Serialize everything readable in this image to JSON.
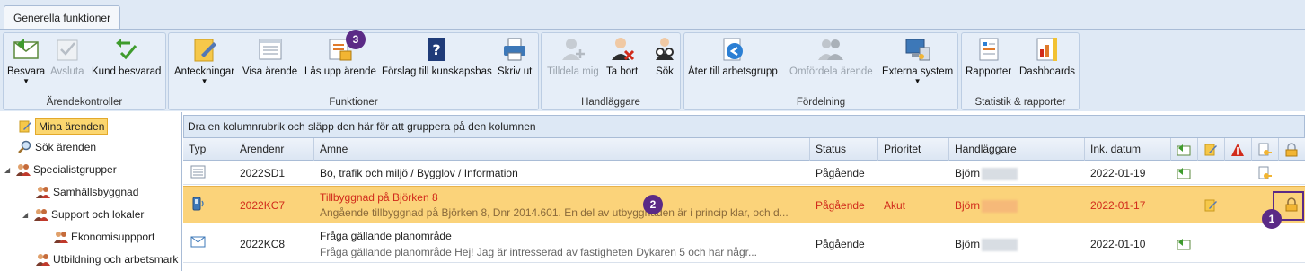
{
  "tab": {
    "label": "Generella funktioner"
  },
  "ribbon": {
    "groups": [
      {
        "caption": "Ärendekontroller",
        "buttons": [
          {
            "label": "Besvara",
            "dropdown": true,
            "enabled": true,
            "icon": "reply-envelope-icon"
          },
          {
            "label": "Avsluta",
            "enabled": false,
            "icon": "check-list-icon"
          },
          {
            "label": "Kund besvarad",
            "enabled": true,
            "icon": "customer-replied-icon"
          }
        ]
      },
      {
        "caption": "Funktioner",
        "buttons": [
          {
            "label": "Anteckningar",
            "dropdown": true,
            "enabled": true,
            "icon": "notes-icon"
          },
          {
            "label": "Visa ärende",
            "enabled": true,
            "icon": "view-case-icon"
          },
          {
            "label": "Lås upp ärende",
            "enabled": true,
            "icon": "unlock-case-icon"
          },
          {
            "label": "Förslag till kunskapsbas",
            "enabled": true,
            "icon": "knowledge-base-icon"
          },
          {
            "label": "Skriv ut",
            "enabled": true,
            "icon": "printer-icon"
          }
        ]
      },
      {
        "caption": "Handläggare",
        "buttons": [
          {
            "label": "Tilldela mig",
            "enabled": false,
            "icon": "assign-me-icon"
          },
          {
            "label": "Ta bort",
            "enabled": true,
            "icon": "remove-user-icon"
          },
          {
            "label": "Sök",
            "enabled": true,
            "icon": "search-users-icon"
          }
        ]
      },
      {
        "caption": "Fördelning",
        "buttons": [
          {
            "label": "Åter till arbetsgrupp",
            "enabled": true,
            "icon": "return-to-group-icon"
          },
          {
            "label": "Omfördela ärende",
            "enabled": false,
            "icon": "redistribute-icon"
          },
          {
            "label": "Externa system",
            "dropdown": true,
            "enabled": true,
            "icon": "external-systems-icon"
          }
        ]
      },
      {
        "caption": "Statistik & rapporter",
        "buttons": [
          {
            "label": "Rapporter",
            "enabled": true,
            "icon": "reports-icon"
          },
          {
            "label": "Dashboards",
            "enabled": true,
            "icon": "dashboards-icon"
          }
        ]
      }
    ]
  },
  "tree": {
    "items": [
      {
        "label": "Mina ärenden",
        "selected": true,
        "icon": "notes-icon"
      },
      {
        "label": "Sök ärenden",
        "icon": "search-icon"
      },
      {
        "label": "Specialistgrupper",
        "icon": "group-icon",
        "expander": "◢"
      },
      {
        "label": "Samhällsbyggnad",
        "icon": "group-icon"
      },
      {
        "label": "Support och lokaler",
        "icon": "group-icon",
        "expander": "◢"
      },
      {
        "label": "Ekonomisuppport",
        "icon": "group-icon"
      },
      {
        "label": "Utbildning och arbetsmark",
        "icon": "group-icon"
      }
    ]
  },
  "grid": {
    "group_hint": "Dra en kolumnrubrik och släpp den här för att gruppera på den kolumnen",
    "columns": [
      "Typ",
      "Ärendenr",
      "Ämne",
      "Status",
      "Prioritet",
      "Handläggare",
      "Ink. datum"
    ],
    "icon_columns": [
      "reply-icon",
      "notes-icon",
      "warning-icon",
      "key-document-icon",
      "lock-icon"
    ],
    "rows": [
      {
        "type_icon": "document-icon",
        "id": "2022SD1",
        "subject": "Bo, trafik och miljö / Bygglov / Information",
        "preview": "",
        "status": "Pågående",
        "priority": "",
        "handler": "Björn",
        "date": "2022-01-19",
        "flags": [
          "reply-icon",
          "",
          "",
          "key-document-icon",
          ""
        ]
      },
      {
        "type_icon": "phone-icon",
        "id": "2022KC7",
        "subject": "Tillbyggnad på Björken 8",
        "preview": "Angående tillbyggnad på Björken 8, Dnr 2014.601. En del av utbyggnaden är i princip klar, och d...",
        "status": "Pågående",
        "priority": "Akut",
        "handler": "Björn",
        "date": "2022-01-17",
        "flags": [
          "",
          "notes-icon",
          "",
          "",
          "lock-icon"
        ],
        "selected": true
      },
      {
        "type_icon": "email-icon",
        "id": "2022KC8",
        "subject": "Fråga gällande planområde",
        "preview": "Fråga gällande planområde Hej! Jag är intresserad av fastigheten Dykaren 5 och har någr...",
        "status": "Pågående",
        "priority": "",
        "handler": "Björn",
        "date": "2022-01-10",
        "flags": [
          "reply-icon",
          "",
          "",
          "",
          ""
        ]
      }
    ]
  },
  "annotations": {
    "badge1": "1",
    "badge2": "2",
    "badge3": "3"
  }
}
